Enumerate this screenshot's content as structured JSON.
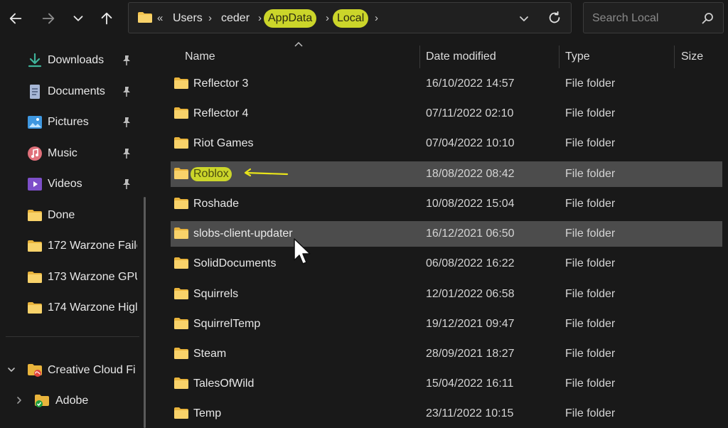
{
  "address": {
    "overflow": "«",
    "crumbs": [
      "Users",
      "ceder",
      "AppData",
      "Local"
    ],
    "highlighted": [
      "AppData",
      "Local"
    ]
  },
  "search": {
    "placeholder": "Search Local"
  },
  "sidebar": {
    "items": [
      {
        "label": "Downloads",
        "icon": "download-icon",
        "pinned": true
      },
      {
        "label": "Documents",
        "icon": "document-icon",
        "pinned": true
      },
      {
        "label": "Pictures",
        "icon": "pictures-icon",
        "pinned": true
      },
      {
        "label": "Music",
        "icon": "music-icon",
        "pinned": true
      },
      {
        "label": "Videos",
        "icon": "videos-icon",
        "pinned": true
      },
      {
        "label": "Done",
        "icon": "folder-icon",
        "pinned": false
      },
      {
        "label": "172 Warzone Faile",
        "icon": "folder-icon",
        "pinned": false
      },
      {
        "label": "173 Warzone GPU",
        "icon": "folder-icon",
        "pinned": false
      },
      {
        "label": "174 Warzone Higl",
        "icon": "folder-icon",
        "pinned": false
      }
    ],
    "tree": [
      {
        "label": "Creative Cloud Fi",
        "icon": "creative-cloud-icon",
        "expanded": true
      },
      {
        "label": "Adobe",
        "icon": "folder-synced-icon",
        "expanded": false
      }
    ]
  },
  "columns": {
    "name": "Name",
    "date": "Date modified",
    "type": "Type",
    "size": "Size"
  },
  "rows": [
    {
      "name": "Reflector 3",
      "date": "16/10/2022 14:57",
      "type": "File folder"
    },
    {
      "name": "Reflector 4",
      "date": "07/11/2022 02:10",
      "type": "File folder"
    },
    {
      "name": "Riot Games",
      "date": "07/04/2022 10:10",
      "type": "File folder"
    },
    {
      "name": "Roblox",
      "date": "18/08/2022 08:42",
      "type": "File folder",
      "state": "selected",
      "highlighted": true
    },
    {
      "name": "Roshade",
      "date": "10/08/2022 15:04",
      "type": "File folder"
    },
    {
      "name": "slobs-client-updater",
      "date": "16/12/2021 06:50",
      "type": "File folder",
      "state": "hover"
    },
    {
      "name": "SolidDocuments",
      "date": "06/08/2022 16:22",
      "type": "File folder"
    },
    {
      "name": "Squirrels",
      "date": "12/01/2022 06:58",
      "type": "File folder"
    },
    {
      "name": "SquirrelTemp",
      "date": "19/12/2021 09:47",
      "type": "File folder"
    },
    {
      "name": "Steam",
      "date": "28/09/2021 18:27",
      "type": "File folder"
    },
    {
      "name": "TalesOfWild",
      "date": "15/04/2022 16:11",
      "type": "File folder"
    },
    {
      "name": "Temp",
      "date": "23/11/2022 10:15",
      "type": "File folder"
    }
  ],
  "colors": {
    "highlight": "#cbd52a",
    "folder": "#f4c44e",
    "background": "#191919",
    "selection": "#4c4c4c"
  }
}
